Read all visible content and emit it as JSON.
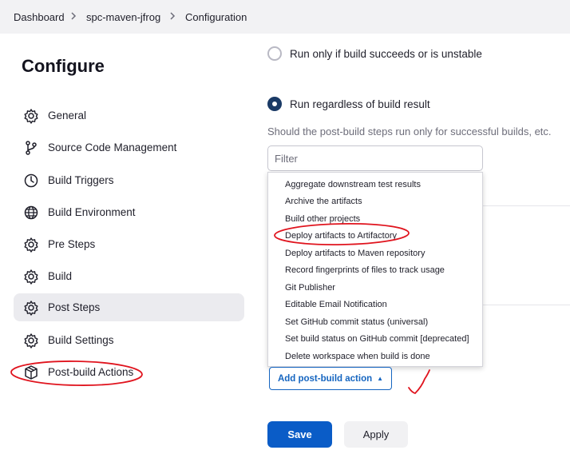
{
  "breadcrumb": {
    "items": [
      "Dashboard",
      "spc-maven-jfrog",
      "Configuration"
    ]
  },
  "sidebar": {
    "title": "Configure",
    "items": [
      {
        "label": "General",
        "icon": "gear-icon"
      },
      {
        "label": "Source Code Management",
        "icon": "branch-icon"
      },
      {
        "label": "Build Triggers",
        "icon": "clock-icon"
      },
      {
        "label": "Build Environment",
        "icon": "globe-icon"
      },
      {
        "label": "Pre Steps",
        "icon": "gear-icon"
      },
      {
        "label": "Build",
        "icon": "gear-icon"
      },
      {
        "label": "Post Steps",
        "icon": "gear-icon",
        "active": true
      },
      {
        "label": "Build Settings",
        "icon": "gear-icon"
      },
      {
        "label": "Post-build Actions",
        "icon": "package-icon"
      }
    ]
  },
  "main": {
    "radio_options": [
      {
        "label": "Run only if build succeeds or is unstable",
        "checked": false
      },
      {
        "label": "Run regardless of build result",
        "checked": true
      }
    ],
    "helper_text": "Should the post-build steps run only for successful builds, etc.",
    "filter": {
      "value": "",
      "placeholder": "Filter"
    },
    "menu_items": [
      "Aggregate downstream test results",
      "Archive the artifacts",
      "Build other projects",
      "Deploy artifacts to Artifactory",
      "Deploy artifacts to Maven repository",
      "Record fingerprints of files to track usage",
      "Git Publisher",
      "Editable Email Notification",
      "Set GitHub commit status (universal)",
      "Set build status on GitHub commit [deprecated]",
      "Delete workspace when build is done"
    ],
    "add_action_label": "Add post-build action",
    "save_label": "Save",
    "apply_label": "Apply"
  },
  "colors": {
    "primary": "#0a5cc7",
    "radio_checked": "#1a3a66",
    "annotation": "#e0141e"
  }
}
